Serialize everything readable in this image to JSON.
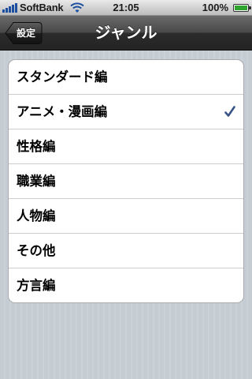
{
  "status_bar": {
    "carrier": "SoftBank",
    "time": "21:05",
    "battery_percent": "100%",
    "battery_level": 1.0,
    "signal_bars": 5,
    "icons": [
      "signal-icon",
      "wifi-icon",
      "battery-icon"
    ]
  },
  "nav": {
    "back_label": "設定",
    "title": "ジャンル"
  },
  "genres": {
    "items": [
      {
        "label": "スタンダード編",
        "checked": false
      },
      {
        "label": "アニメ・漫画編",
        "checked": true
      },
      {
        "label": "性格編",
        "checked": false
      },
      {
        "label": "職業編",
        "checked": false
      },
      {
        "label": "人物編",
        "checked": false
      },
      {
        "label": "その他",
        "checked": false
      },
      {
        "label": "方言編",
        "checked": false
      }
    ]
  },
  "colors": {
    "checkmark": "#385487",
    "nav_bar": "#2c2c2c",
    "background": "#c5ccd4"
  }
}
